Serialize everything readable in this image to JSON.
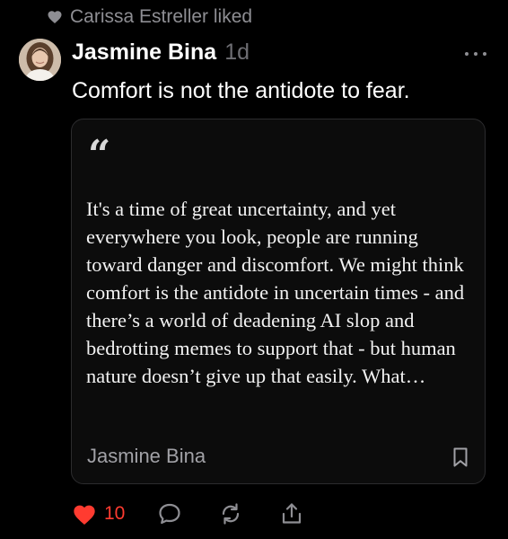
{
  "activity": {
    "liked_by_text": "Carissa Estreller liked",
    "icon": "heart-icon"
  },
  "post": {
    "author_name": "Jasmine Bina",
    "time_ago": "1d",
    "text": "Comfort is not the antidote to fear.",
    "more_icon": "more-horizontal-icon"
  },
  "quote": {
    "mark": "“",
    "excerpt": "It's a time of great uncertainty, and yet everywhere you look, people are running toward danger and discomfort. We might think comfort is the antidote in uncertain times - and there’s a world of deadening AI slop and bedrotting memes to support that - but human nature doesn’t give up that easily. What…",
    "author": "Jasmine Bina",
    "bookmark_icon": "bookmark-icon"
  },
  "actions": {
    "like_count": "10",
    "like_icon": "heart-filled-icon",
    "comment_icon": "comment-icon",
    "restack_icon": "restack-icon",
    "share_icon": "share-icon"
  },
  "colors": {
    "background": "#000000",
    "like_red": "#ff3b30",
    "muted_text": "#8e8e93",
    "card_border": "#2c2c2e"
  }
}
